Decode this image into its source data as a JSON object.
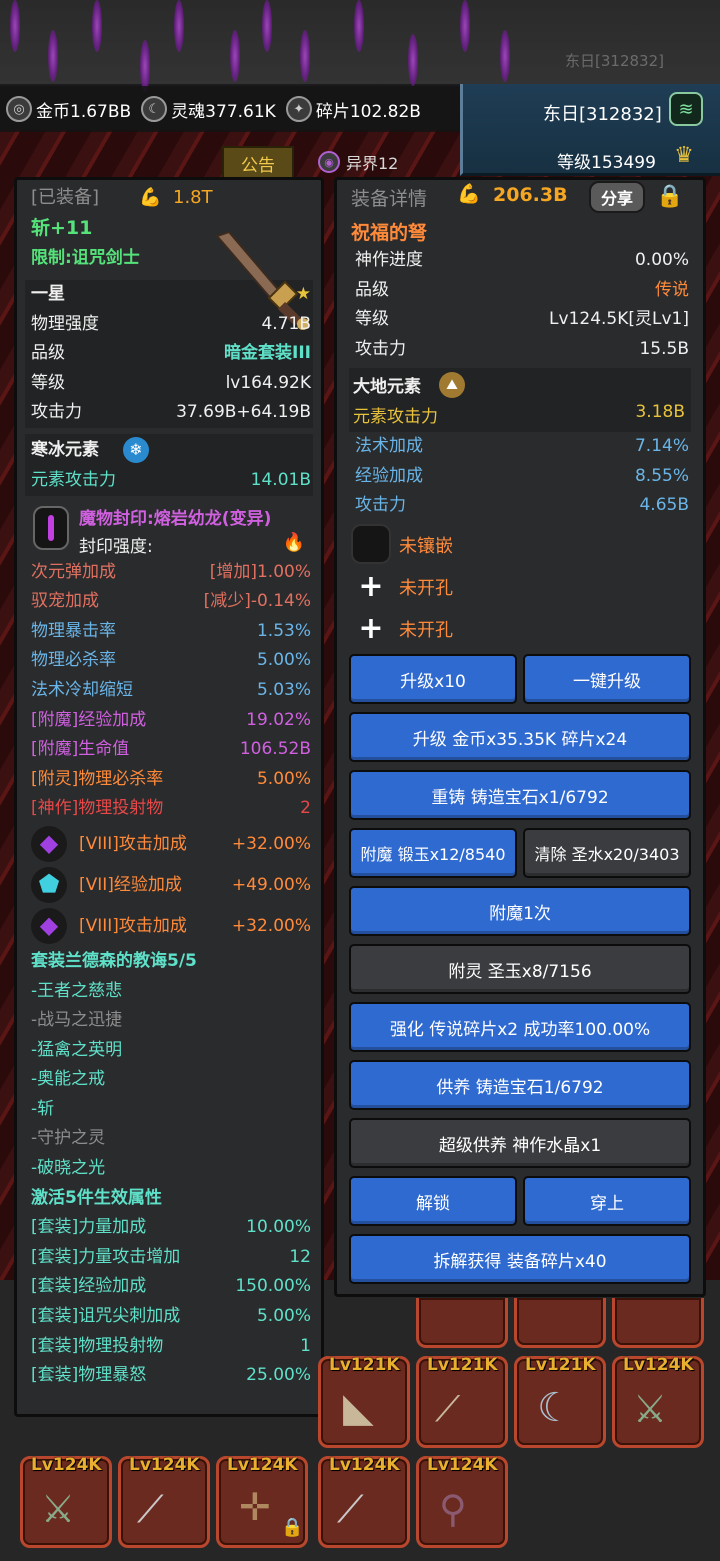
{
  "background": {
    "server_tag": "东日[312832]"
  },
  "resources": {
    "gold_label": "金币1.67BB",
    "soul_label": "灵魂377.61K",
    "shard_label": "碎片102.82B"
  },
  "player": {
    "name": "东日[312832]",
    "level": "等级153499"
  },
  "announce_label": "公告",
  "otherworld_label": "异界12",
  "left_panel": {
    "header": "[已装备]",
    "power": "1.8T",
    "item_name": "斩+11",
    "restriction": "限制:诅咒剑士",
    "star_label": "一星",
    "base_stats": [
      {
        "label": "物理强度",
        "value": "4.71B",
        "value_color": "white"
      },
      {
        "label": "品级",
        "value": "暗金套装III",
        "value_color": "cyan"
      },
      {
        "label": "等级",
        "value": "lv164.92K",
        "value_color": "white"
      },
      {
        "label": "攻击力",
        "value": "37.69B+64.19B",
        "value_color": "white"
      }
    ],
    "element_name": "寒冰元素",
    "element_stat": {
      "label": "元素攻击力",
      "value": "14.01B"
    },
    "seal_name": "魔物封印:熔岩幼龙(变异)",
    "seal_strength_label": "封印强度:",
    "seal_stats": [
      {
        "label": "次元弹加成",
        "value": "[增加]1.00%"
      },
      {
        "label": "驭宠加成",
        "value": "[减少]-0.14%"
      }
    ],
    "extra_stats": [
      {
        "label": "物理暴击率",
        "value": "1.53%",
        "color": "blue"
      },
      {
        "label": "物理必杀率",
        "value": "5.00%",
        "color": "blue"
      },
      {
        "label": "法术冷却缩短",
        "value": "5.03%",
        "color": "blue"
      },
      {
        "label": "[附魔]经验加成",
        "value": "19.02%",
        "color": "magenta"
      },
      {
        "label": "[附魔]生命值",
        "value": "106.52B",
        "color": "magenta"
      },
      {
        "label": "[附灵]物理必杀率",
        "value": "5.00%",
        "color": "orange"
      },
      {
        "label": "[神作]物理投射物",
        "value": "2",
        "color": "red"
      }
    ],
    "gems": [
      {
        "label": "[VIII]攻击加成",
        "value": "+32.00%",
        "icon": "purple-gem-icon"
      },
      {
        "label": "[VII]经验加成",
        "value": "+49.00%",
        "icon": "cyan-gem-icon"
      },
      {
        "label": "[VIII]攻击加成",
        "value": "+32.00%",
        "icon": "purple-gem-icon"
      }
    ],
    "set_title": "套装兰德森的教诲5/5",
    "set_pieces": [
      {
        "label": "-王者之慈悲",
        "active": true
      },
      {
        "label": "-战马之迅捷",
        "active": false
      },
      {
        "label": "-猛禽之英明",
        "active": true
      },
      {
        "label": "-奥能之戒",
        "active": true
      },
      {
        "label": "-斩",
        "active": true
      },
      {
        "label": "-守护之灵",
        "active": false
      },
      {
        "label": "-破晓之光",
        "active": true
      }
    ],
    "set_bonus_title": "激活5件生效属性",
    "set_bonuses": [
      {
        "label": "[套装]力量加成",
        "value": "10.00%"
      },
      {
        "label": "[套装]力量攻击增加",
        "value": "12"
      },
      {
        "label": "[套装]经验加成",
        "value": "150.00%"
      },
      {
        "label": "[套装]诅咒尖刺加成",
        "value": "5.00%"
      },
      {
        "label": "[套装]物理投射物",
        "value": "1"
      },
      {
        "label": "[套装]物理暴怒",
        "value": "25.00%"
      }
    ]
  },
  "right_panel": {
    "header": "装备详情",
    "power": "206.3B",
    "share_label": "分享",
    "item_name": "祝福的弩",
    "stats": [
      {
        "label": "神作进度",
        "value": "0.00%",
        "value_color": "white"
      },
      {
        "label": "品级",
        "value": "传说",
        "value_color": "orange"
      },
      {
        "label": "等级",
        "value": "Lv124.5K[灵Lv1]",
        "value_color": "white"
      },
      {
        "label": "攻击力",
        "value": "15.5B",
        "value_color": "white"
      }
    ],
    "element_name": "大地元素",
    "element_stat": {
      "label": "元素攻击力",
      "value": "3.18B"
    },
    "extra_stats": [
      {
        "label": "法术加成",
        "value": "7.14%"
      },
      {
        "label": "经验加成",
        "value": "8.55%"
      },
      {
        "label": "攻击力",
        "value": "4.65B"
      }
    ],
    "sockets": [
      "未镶嵌",
      "未开孔",
      "未开孔"
    ],
    "buttons": {
      "upgrade10": "升级x10",
      "upgrade_all": "一键升级",
      "upgrade_cost": "升级 金币x35.35K 碎片x24",
      "recast": "重铸 铸造宝石x1/6792",
      "enchant": "附魔 锻玉x12/8540",
      "clear": "清除 圣水x20/3403",
      "enchant_once": "附魔1次",
      "spirit": "附灵 圣玉x8/7156",
      "strengthen": "强化 传说碎片x2 成功率100.00%",
      "nurture": "供养 铸造宝石1/6792",
      "super_nurture": "超级供养 神作水晶x1",
      "unlock": "解锁",
      "equip": "穿上",
      "dismantle": "拆解获得 装备碎片x40"
    }
  },
  "inventory": {
    "row1_levels": [
      "Lv121K",
      "Lv121K",
      "Lv121K",
      "Lv124K"
    ],
    "row2_levels": [
      "Lv124K",
      "Lv124K",
      "Lv124K",
      "Lv124K",
      "Lv124K"
    ]
  },
  "colors": {
    "panel_bg": "#2a2b2d",
    "button_blue": "#2f6ad0",
    "button_grey": "#3b3c3f",
    "accent_orange": "#ff8a3a",
    "set_teal": "#5fe0c8"
  }
}
